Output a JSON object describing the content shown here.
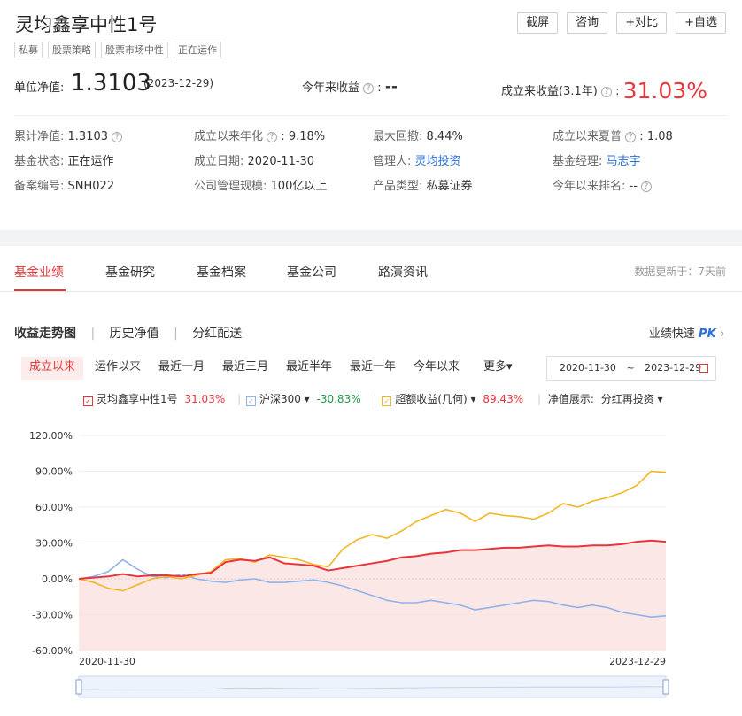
{
  "header": {
    "title": "灵均鑫享中性1号",
    "tags": [
      "私募",
      "股票策略",
      "股票市场中性",
      "正在运作"
    ],
    "buttons": [
      "截屏",
      "咨询",
      "+对比",
      "+自选"
    ]
  },
  "nav": {
    "label": "单位净值:",
    "value": "1.3103",
    "date": "(2023-12-29)",
    "ytd_label": "今年来收益",
    "ytd_value": "--",
    "since_label": "成立来收益(3.1年)",
    "since_value": "31.03%"
  },
  "details": [
    [
      {
        "k": "累计净值:",
        "v": "1.3103",
        "q": true
      },
      {
        "k": "成立以来年化",
        "v": "9.18%",
        "q": true
      },
      {
        "k": "最大回撤:",
        "v": "8.44%"
      },
      {
        "k": "成立以来夏普",
        "v": "1.08",
        "q": true
      }
    ],
    [
      {
        "k": "基金状态:",
        "v": "正在运作"
      },
      {
        "k": "成立日期:",
        "v": "2020-11-30"
      },
      {
        "k": "管理人:",
        "v": "灵均投资",
        "link": true
      },
      {
        "k": "基金经理:",
        "v": "马志宇",
        "link": true
      }
    ],
    [
      {
        "k": "备案编号:",
        "v": "SNH022"
      },
      {
        "k": "公司管理规模:",
        "v": "100亿以上"
      },
      {
        "k": "产品类型:",
        "v": "私募证券"
      },
      {
        "k": "今年以来排名:",
        "v": "--",
        "q": true
      }
    ]
  ],
  "tabs": [
    "基金业绩",
    "基金研究",
    "基金档案",
    "基金公司",
    "路演资讯"
  ],
  "update_text": "数据更新于：7天前",
  "subtabs": [
    "收益走势图",
    "历史净值",
    "分红配送"
  ],
  "pk_text": "业绩快速",
  "pk_badge": "PK",
  "ranges": [
    "成立以来",
    "运作以来",
    "最近一月",
    "最近三月",
    "最近半年",
    "最近一年",
    "今年以来",
    "更多▾"
  ],
  "date_range": {
    "from": "2020-11-30",
    "to": "2023-12-29",
    "sep": "~"
  },
  "legend": [
    {
      "name": "灵均鑫享中性1号",
      "value": "31.03%",
      "color": "#e8353b",
      "value_color": "#e8353b"
    },
    {
      "name": "沪深300 ▾",
      "value": "-30.83%",
      "color": "#8fb4ea",
      "value_color": "#1e9a4a"
    },
    {
      "name": "超额收益(几何) ▾",
      "value": "89.43%",
      "color": "#f2b623",
      "value_color": "#e8353b"
    },
    {
      "name": "净值展示:",
      "value": "分红再投资 ▾",
      "color": "",
      "value_color": "#333"
    }
  ],
  "chart_data": {
    "type": "line",
    "y_tick_labels": [
      "120.00%",
      "90.00%",
      "60.00%",
      "30.00%",
      "0.00%",
      "-30.00%",
      "-60.00%"
    ],
    "x_tick_labels": [
      "2020-11-30",
      "2023-12-29"
    ],
    "ylim": [
      -60,
      120
    ],
    "x": [
      0,
      0.025,
      0.05,
      0.075,
      0.1,
      0.125,
      0.15,
      0.175,
      0.2,
      0.225,
      0.25,
      0.275,
      0.3,
      0.325,
      0.35,
      0.375,
      0.4,
      0.425,
      0.45,
      0.475,
      0.5,
      0.525,
      0.55,
      0.575,
      0.6,
      0.625,
      0.65,
      0.675,
      0.7,
      0.725,
      0.75,
      0.775,
      0.8,
      0.825,
      0.85,
      0.875,
      0.9,
      0.925,
      0.95,
      0.975,
      1.0
    ],
    "series": [
      {
        "name": "灵均鑫享中性1号",
        "color": "#e8353b",
        "values": [
          0,
          1,
          2,
          4,
          2,
          3,
          3,
          2,
          4,
          5,
          14,
          16,
          15,
          18,
          13,
          12,
          11,
          7,
          9,
          11,
          13,
          15,
          18,
          19,
          21,
          22,
          24,
          24,
          25,
          26,
          26,
          27,
          28,
          27,
          27,
          28,
          28,
          29,
          31,
          32,
          31
        ]
      },
      {
        "name": "沪深300",
        "color": "#8fb4ea",
        "values": [
          0,
          2,
          6,
          16,
          8,
          2,
          1,
          4,
          0,
          -2,
          -3,
          -1,
          0,
          -3,
          -3,
          -2,
          -1,
          -3,
          -6,
          -10,
          -14,
          -18,
          -20,
          -20,
          -18,
          -20,
          -22,
          -26,
          -24,
          -22,
          -20,
          -18,
          -19,
          -22,
          -24,
          -22,
          -24,
          -28,
          -30,
          -32,
          -31
        ]
      },
      {
        "name": "超额收益(几何)",
        "color": "#f2b623",
        "values": [
          0,
          -3,
          -8,
          -10,
          -5,
          0,
          2,
          0,
          3,
          6,
          16,
          17,
          14,
          20,
          18,
          16,
          12,
          10,
          25,
          33,
          37,
          34,
          40,
          48,
          53,
          58,
          55,
          48,
          55,
          53,
          52,
          50,
          55,
          63,
          60,
          65,
          68,
          72,
          78,
          90,
          89
        ]
      }
    ]
  }
}
